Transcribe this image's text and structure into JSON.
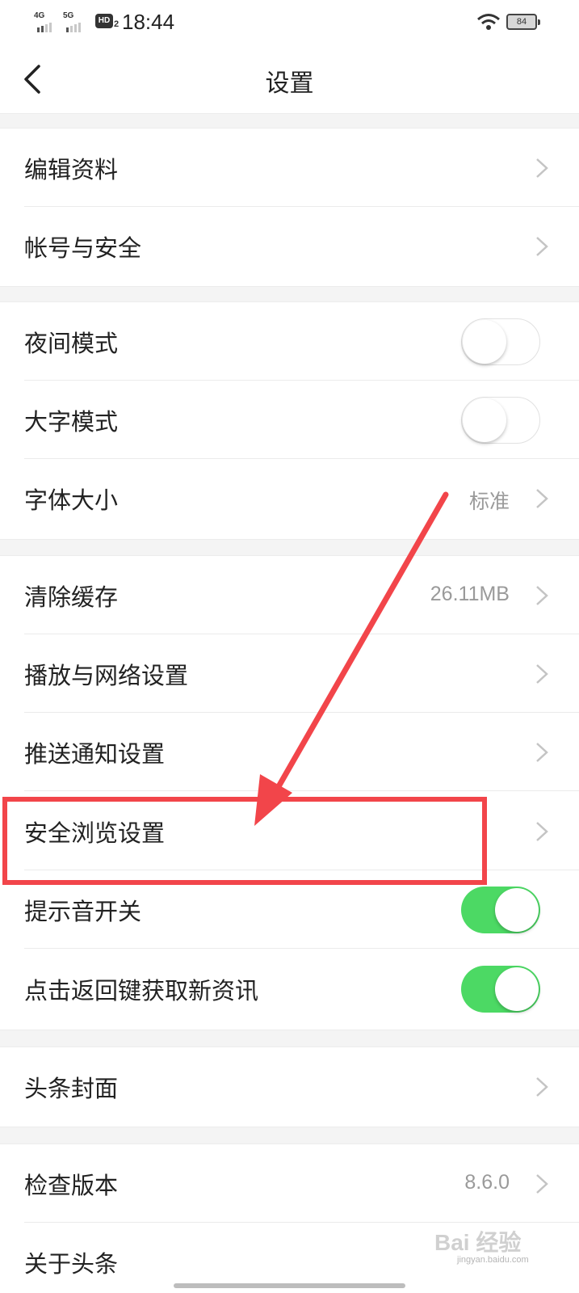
{
  "status_bar": {
    "net1": "4G",
    "net2": "5G",
    "hd": "HD",
    "hd_sub": "2",
    "time": "18:44",
    "battery": "84"
  },
  "header": {
    "title": "设置",
    "back_icon": "chevron-left-icon"
  },
  "groups": {
    "profile": {
      "edit_profile": "编辑资料",
      "account_security": "帐号与安全"
    },
    "display": {
      "night_mode": {
        "label": "夜间模式",
        "on": false
      },
      "large_text_mode": {
        "label": "大字模式",
        "on": false
      },
      "font_size": {
        "label": "字体大小",
        "value": "标准"
      }
    },
    "general": {
      "clear_cache": {
        "label": "清除缓存",
        "value": "26.11MB"
      },
      "playback_network": "播放与网络设置",
      "push_notifications": "推送通知设置",
      "safe_browsing": "安全浏览设置",
      "sound_switch": {
        "label": "提示音开关",
        "on": true
      },
      "back_key_refresh": {
        "label": "点击返回键获取新资讯",
        "on": true
      }
    },
    "cover": {
      "headline_cover": "头条封面"
    },
    "about": {
      "check_version": {
        "label": "检查版本",
        "value": "8.6.0"
      },
      "about_app": "关于头条"
    }
  },
  "watermark": {
    "text": "Bai 经验",
    "url": "jingyan.baidu.com"
  },
  "colors": {
    "toggle_on": "#4cd964",
    "annotation": "#f2454a",
    "background_gap": "#f4f4f4"
  }
}
